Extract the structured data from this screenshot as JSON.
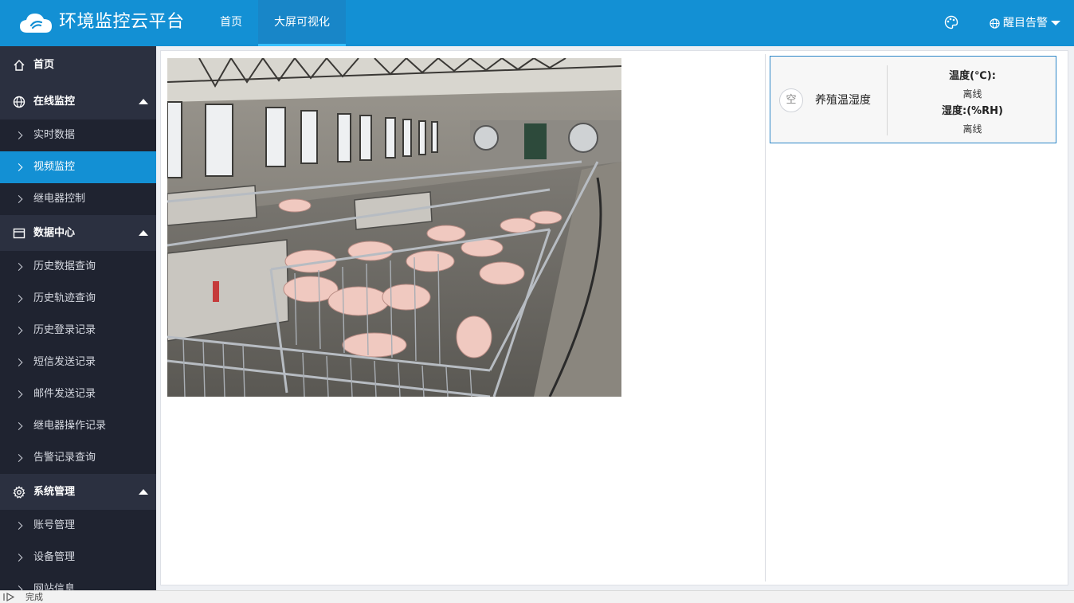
{
  "header": {
    "brand": "环境监控云平台",
    "nav": {
      "home": "首页",
      "big_screen": "大屏可视化"
    },
    "alarm_label": "醒目告警"
  },
  "sidebar": {
    "home": "首页",
    "groups": [
      {
        "label": "在线监控",
        "items": [
          "实时数据",
          "视频监控",
          "继电器控制"
        ]
      },
      {
        "label": "数据中心",
        "items": [
          "历史数据查询",
          "历史轨迹查询",
          "历史登录记录",
          "短信发送记录",
          "邮件发送记录",
          "继电器操作记录",
          "告警记录查询"
        ]
      },
      {
        "label": "系统管理",
        "items": [
          "账号管理",
          "设备管理",
          "网站信息"
        ]
      }
    ],
    "active_item": "视频监控"
  },
  "device_card": {
    "badge": "空",
    "name": "养殖温湿度",
    "temp_label": "温度(℃):",
    "temp_value": "离线",
    "hum_label": "湿度:(%RH)",
    "hum_value": "离线"
  },
  "statusbar": {
    "text": "完成"
  },
  "colors": {
    "topbar": "#1390d4",
    "sidebar": "#1f2330",
    "active": "#1390d4",
    "card_border": "#2c86c7"
  }
}
